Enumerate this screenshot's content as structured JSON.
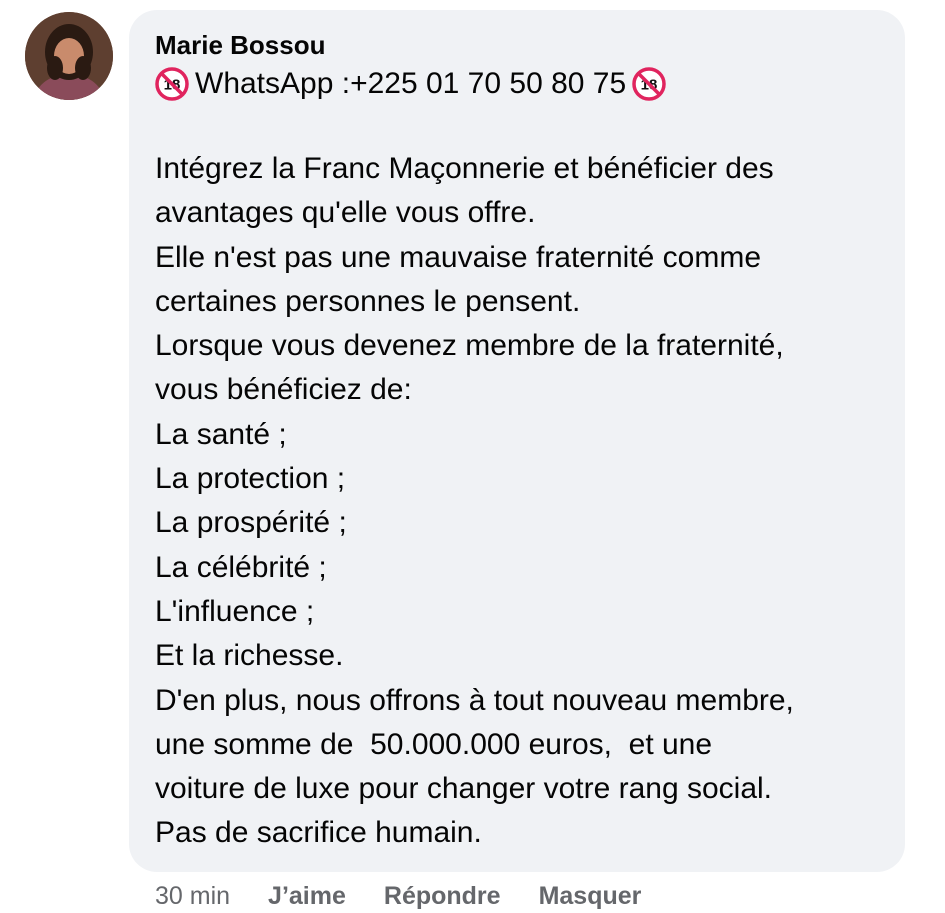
{
  "comment": {
    "author": "Marie Bossou",
    "avatar_icon": "profile-photo",
    "contact": {
      "prefix_icon": "no-under-18-emoji",
      "text": "WhatsApp :+225 01 70 50 80 75",
      "suffix_icon": "no-under-18-emoji"
    },
    "lines": [
      "Intégrez la Franc Maçonnerie et bénéficier des",
      "avantages qu'elle vous offre.",
      "Elle n'est pas une mauvaise fraternité comme",
      "certaines personnes le pensent.",
      "Lorsque vous devenez membre de la fraternité,",
      "vous bénéficiez de:",
      "La santé ;",
      "La protection ;",
      "La prospérité ;",
      "La célébrité ;",
      "L'influence ;",
      "Et la richesse.",
      "D'en plus, nous offrons à tout nouveau membre,",
      "une somme de  50.000.000 euros,  et une",
      "voiture de luxe pour changer votre rang social.",
      "Pas de sacrifice humain."
    ]
  },
  "actions": {
    "timestamp": "30 min",
    "like_label": "J’aime",
    "reply_label": "Répondre",
    "hide_label": "Masquer"
  },
  "colors": {
    "bubble_bg": "#f0f2f5",
    "text": "#050505",
    "meta_text": "#65676b",
    "no18_red": "#e0245e"
  }
}
